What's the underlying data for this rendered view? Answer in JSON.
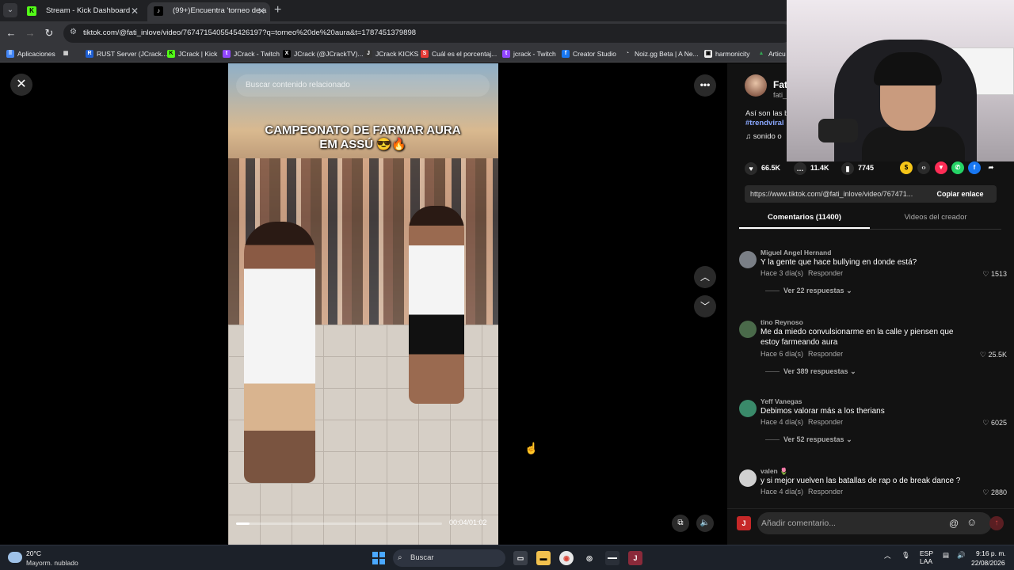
{
  "browser": {
    "tabs": [
      {
        "label": "Stream - Kick Dashboard",
        "icon": "kick-icon"
      },
      {
        "label": "(99+)Encuentra 'torneo de a",
        "icon": "tiktok-icon"
      }
    ],
    "url": "tiktok.com/@fati_inlove/video/7674715405545426197?q=torneo%20de%20aura&t=1787451379898",
    "bookmarks": [
      {
        "label": "Aplicaciones"
      },
      {
        "label": "RUST Server (JCrack..."
      },
      {
        "label": "JCrack | Kick"
      },
      {
        "label": "JCrack - Twitch"
      },
      {
        "label": "JCrack (@JCrackTV)..."
      },
      {
        "label": "JCrack KICKS"
      },
      {
        "label": "Cuál es el porcentaj..."
      },
      {
        "label": "jcrack - Twitch"
      },
      {
        "label": "Creator Studio"
      },
      {
        "label": "Noiz.gg Beta | A Ne..."
      },
      {
        "label": "harmonicity"
      },
      {
        "label": "Articu"
      }
    ]
  },
  "video": {
    "search_placeholder": "Buscar contenido relacionado",
    "caption": "CAMPEONATO DE FARMAR AURA EM ASSÚ 😎🔥",
    "time": "00:04/01:02",
    "progress": 0.065
  },
  "creator": {
    "name": "Fat",
    "handle": "fati_",
    "description": "Así son las b",
    "hashtag": "#trendviral",
    "sound": "sonido o"
  },
  "stats": {
    "likes": "66.5K",
    "comments": "11.4K",
    "saves": "7745"
  },
  "link": {
    "url": "https://www.tiktok.com/@fati_inlove/video/767471...",
    "copy_label": "Copiar enlace"
  },
  "panel_tabs": {
    "comments": "Comentarios (11400)",
    "creator_videos": "Videos del creador"
  },
  "comments": [
    {
      "user": "Miguel Angel Hernand",
      "text": "Y la gente que hace bullying en donde está?",
      "time": "Hace 3 día(s)",
      "reply": "Responder",
      "likes": "1513",
      "replies": "Ver 22 respuestas",
      "avatar_color": "#7a7f86"
    },
    {
      "user": "tino Reynoso",
      "text": "Me da miedo convulsionarme en la calle y piensen que estoy farmeando aura",
      "time": "Hace 6 día(s)",
      "reply": "Responder",
      "likes": "25.5K",
      "replies": "Ver 389 respuestas",
      "avatar_color": "#4a6a4a"
    },
    {
      "user": "Yeff Vanegas",
      "text": "Debimos valorar más a los therians",
      "time": "Hace 4 día(s)",
      "reply": "Responder",
      "likes": "6025",
      "replies": "Ver 52 respuestas",
      "avatar_color": "#3a8a6a"
    },
    {
      "user": "valen 🌷",
      "text": "y si mejor vuelven las batallas de rap o de break dance ?",
      "time": "Hace 4 día(s)",
      "reply": "Responder",
      "likes": "2880",
      "replies": "",
      "avatar_color": "#d0d0d0"
    }
  ],
  "composer": {
    "placeholder": "Añadir comentario..."
  },
  "taskbar": {
    "temperature": "20°C",
    "weather": "Mayorm. nublado",
    "search": "Buscar",
    "lang1": "ESP",
    "lang2": "LAA",
    "time": "9:16 p. m.",
    "date": "22/08/2026"
  }
}
